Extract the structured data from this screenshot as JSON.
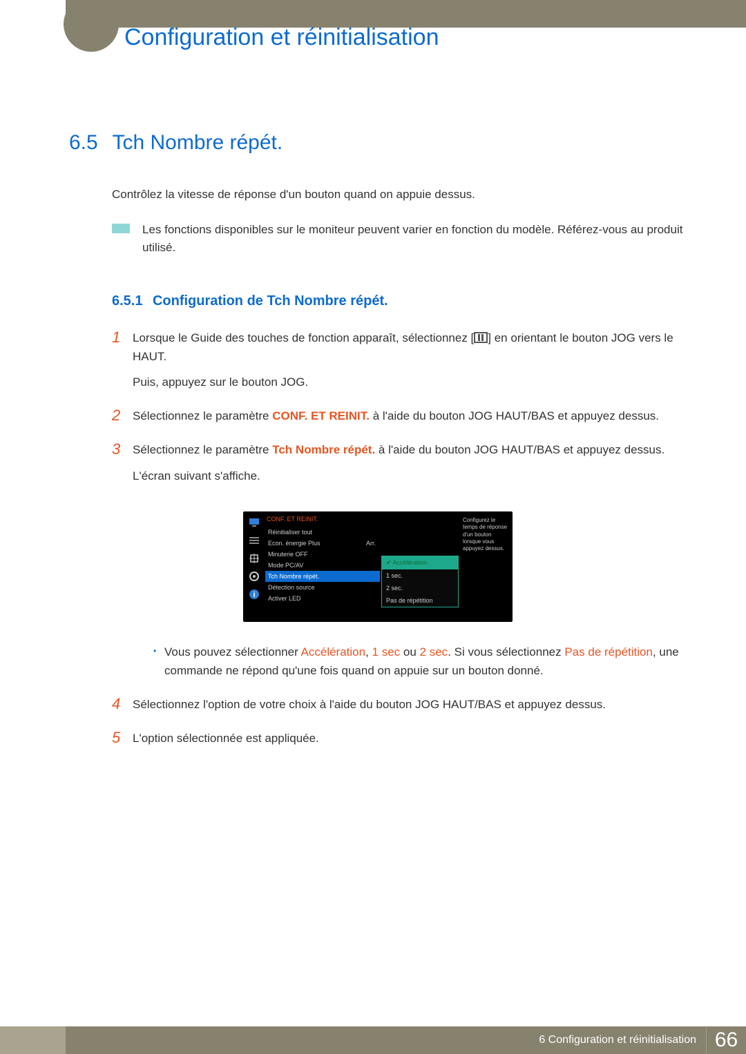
{
  "header": {
    "title": "Configuration et réinitialisation"
  },
  "section": {
    "num": "6.5",
    "title": "Tch Nombre répét."
  },
  "intro": "Contrôlez la vitesse de réponse d'un bouton quand on appuie dessus.",
  "note": "Les fonctions disponibles sur le moniteur peuvent varier en fonction du modèle. Référez-vous au produit utilisé.",
  "subsection": {
    "num": "6.5.1",
    "title": "Configuration de Tch Nombre répét."
  },
  "steps": {
    "s1": {
      "num": "1",
      "a": "Lorsque le Guide des touches de fonction apparaît, sélectionnez [",
      "b": "] en orientant le bouton JOG vers le HAUT.",
      "c": "Puis, appuyez sur le bouton JOG."
    },
    "s2": {
      "num": "2",
      "a": "Sélectionnez le paramètre ",
      "hl": "CONF. ET REINIT.",
      "b": " à l'aide du bouton JOG HAUT/BAS et appuyez dessus."
    },
    "s3": {
      "num": "3",
      "a": "Sélectionnez le paramètre ",
      "hl": "Tch Nombre répét.",
      "b": " à l'aide du bouton JOG HAUT/BAS et appuyez dessus.",
      "c": "L'écran suivant s'affiche."
    },
    "bullet": {
      "a": "Vous pouvez sélectionner ",
      "h1": "Accélération",
      "comma": ", ",
      "h2": "1 sec",
      "or": " ou ",
      "h3": "2 sec",
      "dot": ". Si vous sélectionnez ",
      "h4": "Pas de répétition",
      "b": ", une commande ne répond qu'une fois quand on appuie sur un bouton donné."
    },
    "s4": {
      "num": "4",
      "text": "Sélectionnez l'option de votre choix à l'aide du bouton JOG HAUT/BAS et appuyez dessus."
    },
    "s5": {
      "num": "5",
      "text": "L'option sélectionnée est appliquée."
    }
  },
  "osd": {
    "title": "CONF. ET REINIT.",
    "items": {
      "i0": "Réinitialiser tout",
      "i1": "Econ. énergie Plus",
      "i1v": "Arr.",
      "i2": "Minuterie OFF",
      "i3": "Mode PC/AV",
      "i4": "Tch Nombre répét.",
      "i5": "Détection source",
      "i6": "Activer LED"
    },
    "submenu": {
      "o0": "Accélération",
      "o1": "1 sec.",
      "o2": "2 sec.",
      "o3": "Pas de répétition"
    },
    "help": "Configurez le temps de réponse d'un bouton lorsque vous appuyez dessus."
  },
  "footer": {
    "chapter": "6 Configuration et réinitialisation",
    "page": "66"
  }
}
